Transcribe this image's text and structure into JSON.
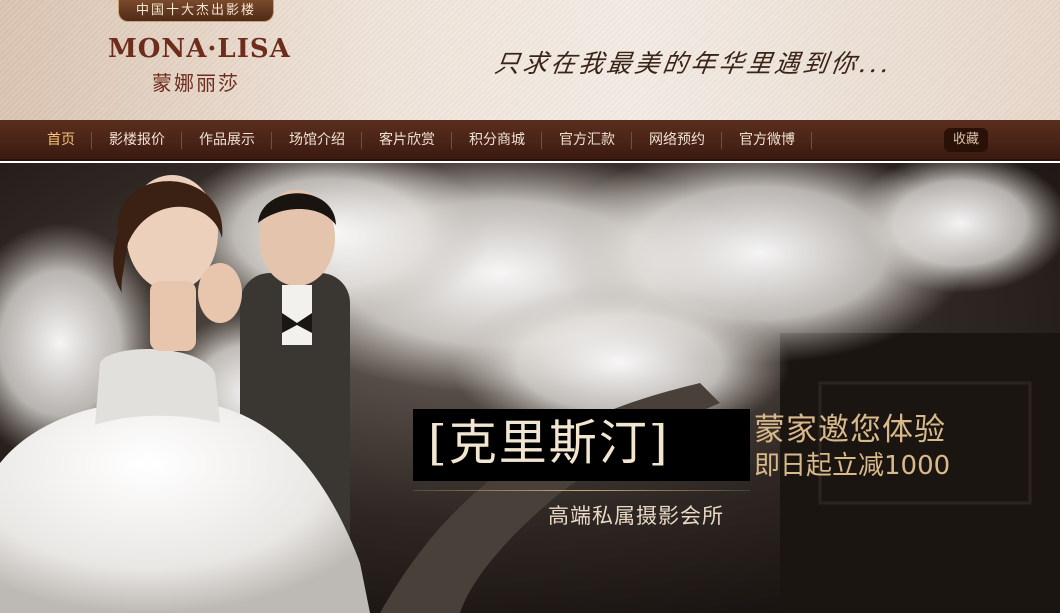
{
  "header": {
    "badge": "中国十大杰出影楼",
    "logo_en": "MONA·LISA",
    "logo_cn": "蒙娜丽莎",
    "slogan": "只求在我最美的年华里遇到你..."
  },
  "nav": {
    "items": [
      {
        "label": "首页",
        "active": true
      },
      {
        "label": "影楼报价"
      },
      {
        "label": "作品展示"
      },
      {
        "label": "场馆介绍"
      },
      {
        "label": "客片欣赏"
      },
      {
        "label": "积分商城"
      },
      {
        "label": "官方汇款"
      },
      {
        "label": "网络预约"
      },
      {
        "label": "官方微博"
      }
    ],
    "favorite_label": "收藏"
  },
  "banner": {
    "title": "[克里斯汀]",
    "line1": "蒙家邀您体验",
    "line2": "即日起立减1000",
    "subtitle": "高端私属摄影会所"
  },
  "colors": {
    "nav_bg": "#4a2417",
    "brand": "#6d2c1c",
    "accent_gold": "#d9b98a",
    "active_nav": "#f6c57a"
  }
}
